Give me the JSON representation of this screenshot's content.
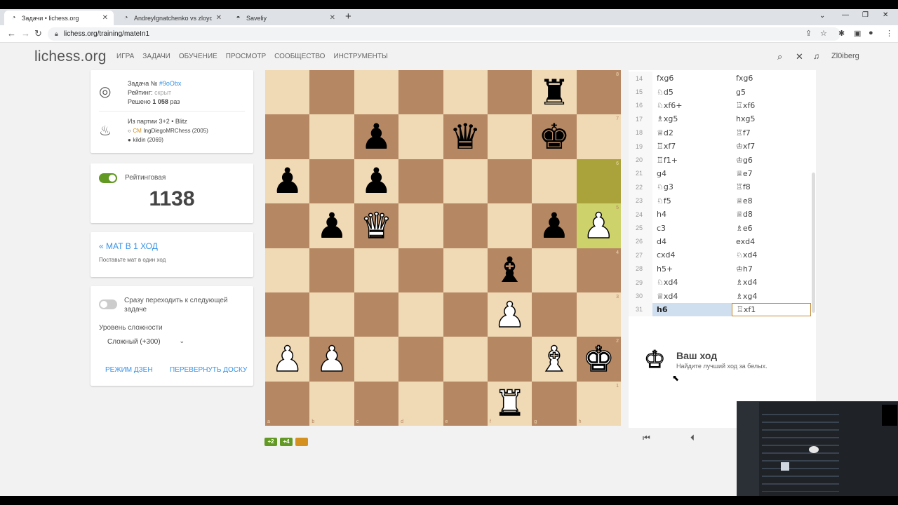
{
  "browser": {
    "tabs": [
      {
        "title": "Задачи • lichess.org",
        "active": true
      },
      {
        "title": "AndreyIgnatchenko vs zloydam",
        "active": false
      },
      {
        "title": "Saveliy",
        "active": false
      }
    ],
    "url": "lichess.org/training/mateIn1"
  },
  "site": {
    "logo": "lichess.org",
    "nav": [
      "ИГРА",
      "ЗАДАЧИ",
      "ОБУЧЕНИЕ",
      "ПРОСМОТР",
      "СООБЩЕСТВО",
      "ИНСТРУМЕНТЫ"
    ],
    "username": "Zl0iberg"
  },
  "puzzle": {
    "id_label": "Задача №",
    "id": "#9oObx",
    "rating_label": "Рейтинг:",
    "rating_value": "скрыт",
    "solved_label": "Решено",
    "solved_count": "1 058",
    "solved_suffix": "раз",
    "from_game": "Из партии 3+2 • Blitz",
    "white_title": "CM",
    "white_player": "IngDiegoMRChess (2005)",
    "black_player": "kildin (2069)"
  },
  "rated": {
    "label": "Рейтинговая",
    "rating": "1138"
  },
  "theme": {
    "title": "« МАТ В 1 ХОД",
    "description": "Поставьте мат в один ход"
  },
  "settings": {
    "auto_next": "Сразу переходить к следующей задаче",
    "difficulty_label": "Уровень сложности",
    "difficulty_value": "Сложный (+300)",
    "zen_button": "РЕЖИМ ДЗЕН",
    "flip_button": "ПЕРЕВЕРНУТЬ ДОСКУ"
  },
  "board": {
    "rank_labels": [
      "8",
      "7",
      "6",
      "5",
      "4",
      "3",
      "2",
      "1"
    ],
    "file_labels": [
      "a",
      "b",
      "c",
      "d",
      "e",
      "f",
      "g",
      "h"
    ],
    "last_move_squares": [
      "h6",
      "h5"
    ],
    "pieces": [
      {
        "square": "g8",
        "piece": "rook",
        "color": "black"
      },
      {
        "square": "e7",
        "piece": "queen",
        "color": "black"
      },
      {
        "square": "g7",
        "piece": "king",
        "color": "black"
      },
      {
        "square": "c7",
        "piece": "pawn",
        "color": "black"
      },
      {
        "square": "a6",
        "piece": "pawn",
        "color": "black"
      },
      {
        "square": "c6",
        "piece": "pawn",
        "color": "black"
      },
      {
        "square": "b5",
        "piece": "pawn",
        "color": "black"
      },
      {
        "square": "c5",
        "piece": "queen",
        "color": "white"
      },
      {
        "square": "g5",
        "piece": "pawn",
        "color": "black"
      },
      {
        "square": "h5",
        "piece": "pawn",
        "color": "white"
      },
      {
        "square": "f4",
        "piece": "bishop",
        "color": "black"
      },
      {
        "square": "f3",
        "piece": "pawn",
        "color": "white"
      },
      {
        "square": "a2",
        "piece": "pawn",
        "color": "white"
      },
      {
        "square": "b2",
        "piece": "pawn",
        "color": "white"
      },
      {
        "square": "g2",
        "piece": "bishop",
        "color": "white"
      },
      {
        "square": "h2",
        "piece": "king",
        "color": "white"
      },
      {
        "square": "f1",
        "piece": "rook",
        "color": "white"
      }
    ]
  },
  "round_scores": [
    {
      "label": "+2",
      "color": "#629924"
    },
    {
      "label": "+4",
      "color": "#629924"
    },
    {
      "label": "",
      "color": "#d59120"
    }
  ],
  "moves": [
    {
      "n": "14",
      "w": "fxg6",
      "b": "fxg6"
    },
    {
      "n": "15",
      "w": "♘d5",
      "b": "g5"
    },
    {
      "n": "16",
      "w": "♘xf6+",
      "b": "♖xf6"
    },
    {
      "n": "17",
      "w": "♗xg5",
      "b": "hxg5"
    },
    {
      "n": "18",
      "w": "♕d2",
      "b": "♖f7"
    },
    {
      "n": "19",
      "w": "♖xf7",
      "b": "♔xf7"
    },
    {
      "n": "20",
      "w": "♖f1+",
      "b": "♔g6"
    },
    {
      "n": "21",
      "w": "g4",
      "b": "♕e7"
    },
    {
      "n": "22",
      "w": "♘g3",
      "b": "♖f8"
    },
    {
      "n": "23",
      "w": "♘f5",
      "b": "♕e8"
    },
    {
      "n": "24",
      "w": "h4",
      "b": "♕d8"
    },
    {
      "n": "25",
      "w": "c3",
      "b": "♗e6"
    },
    {
      "n": "26",
      "w": "d4",
      "b": "exd4"
    },
    {
      "n": "27",
      "w": "cxd4",
      "b": "♘xd4"
    },
    {
      "n": "28",
      "w": "h5+",
      "b": "♔h7"
    },
    {
      "n": "29",
      "w": "♘xd4",
      "b": "♗xd4"
    },
    {
      "n": "30",
      "w": "♕xd4",
      "b": "♗xg4"
    },
    {
      "n": "31",
      "w": "h6",
      "b": "♖xf1"
    }
  ],
  "turn": {
    "title": "Ваш ход",
    "subtitle": "Найдите лучший ход за белых."
  },
  "colors": {
    "link": "#3692e7",
    "toggle_on": "#629924",
    "light_square": "#f0d9b5",
    "dark_square": "#b58863"
  }
}
